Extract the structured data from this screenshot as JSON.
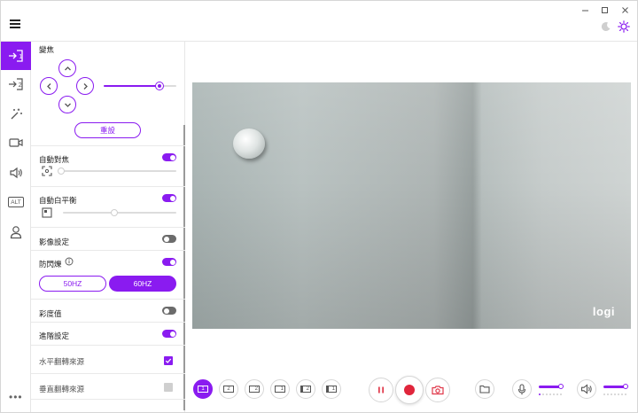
{
  "app": {
    "accent": "#8a1bf0"
  },
  "titlebar": {
    "controls": [
      "minimize-icon",
      "maximize-icon",
      "close-icon"
    ],
    "theme_icons": [
      "moon-icon",
      "sun-icon"
    ]
  },
  "rail": {
    "items": [
      {
        "icon": "camera-1-icon",
        "active": true
      },
      {
        "icon": "camera-2-icon",
        "active": false
      },
      {
        "icon": "magic-wand-icon",
        "active": false
      },
      {
        "icon": "video-camera-icon",
        "active": false
      },
      {
        "icon": "speaker-icon",
        "active": false
      },
      {
        "icon": "alt-icon",
        "label": "ALT",
        "active": false
      },
      {
        "icon": "user-icon",
        "active": false
      }
    ],
    "more": "•••"
  },
  "panel": {
    "zoom_label": "變焦",
    "zoom_value": 0.8,
    "reset_label": "重設",
    "autofocus_label": "自動對焦",
    "autofocus_on": true,
    "focus_value": 0.0,
    "awb_label": "自動白平衡",
    "awb_on": true,
    "wb_value": 0.45,
    "image_settings_label": "影像設定",
    "image_settings_on": false,
    "antiflicker_label": "防閃爍",
    "antiflicker_on": true,
    "hz_options": [
      "50HZ",
      "60HZ"
    ],
    "hz_selected": "60HZ",
    "saturation_label": "彩度值",
    "saturation_on": false,
    "advanced_label": "進階設定",
    "advanced_on": true,
    "mirror_h_label": "水平翻轉來源",
    "mirror_h_checked": true,
    "mirror_v_label": "垂直翻轉來源",
    "mirror_v_checked": false
  },
  "preview": {
    "logo": "logi"
  },
  "toolbar": {
    "layouts": [
      "1",
      "2",
      "2",
      "1",
      "2",
      "1"
    ],
    "active_layout": 0,
    "mic_level": 1.0,
    "speaker_level": 1.0
  }
}
